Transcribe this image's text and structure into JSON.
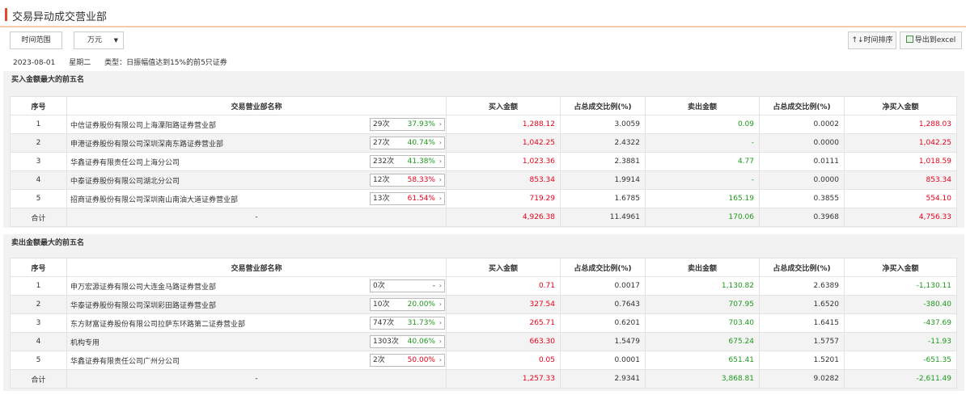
{
  "title": "交易异动成交营业部",
  "toolbar": {
    "range_label": "时间范围",
    "unit_label": "万元",
    "sort_label": "时间排序",
    "sort_icon": "↑↓",
    "export_label": "导出到excel"
  },
  "info": {
    "date": "2023-08-01",
    "weekday": "星期二",
    "type": "类型：日振幅值达到15%的前5只证券"
  },
  "headers": [
    "序号",
    "交易营业部名称",
    "买入金额",
    "占总成交比例(%)",
    "卖出金额",
    "占总成交比例(%)",
    "净买入金额"
  ],
  "buy_section": {
    "title": "买入金额最大的前五名",
    "rows": [
      {
        "idx": "1",
        "name": "中信证券股份有限公司上海溧阳路证券营业部",
        "count": "29次",
        "pct": "37.93%",
        "buy": "1,288.12",
        "buy_ratio": "3.0059",
        "sell": "0.09",
        "sell_ratio": "0.0002",
        "net": "1,288.03"
      },
      {
        "idx": "2",
        "name": "申港证券股份有限公司深圳深南东路证券营业部",
        "count": "27次",
        "pct": "40.74%",
        "buy": "1,042.25",
        "buy_ratio": "2.4322",
        "sell": "-",
        "sell_ratio": "0.0000",
        "net": "1,042.25"
      },
      {
        "idx": "3",
        "name": "华鑫证券有限责任公司上海分公司",
        "count": "232次",
        "pct": "41.38%",
        "buy": "1,023.36",
        "buy_ratio": "2.3881",
        "sell": "4.77",
        "sell_ratio": "0.0111",
        "net": "1,018.59"
      },
      {
        "idx": "4",
        "name": "中泰证券股份有限公司湖北分公司",
        "count": "12次",
        "pct": "58.33%",
        "buy": "853.34",
        "buy_ratio": "1.9914",
        "sell": "-",
        "sell_ratio": "0.0000",
        "net": "853.34"
      },
      {
        "idx": "5",
        "name": "招商证券股份有限公司深圳南山南油大道证券营业部",
        "count": "13次",
        "pct": "61.54%",
        "buy": "719.29",
        "buy_ratio": "1.6785",
        "sell": "165.19",
        "sell_ratio": "0.3855",
        "net": "554.10"
      }
    ],
    "total": {
      "label": "合计",
      "name": "-",
      "buy": "4,926.38",
      "buy_ratio": "11.4961",
      "sell": "170.06",
      "sell_ratio": "0.3968",
      "net": "4,756.33"
    }
  },
  "sell_section": {
    "title": "卖出金额最大的前五名",
    "rows": [
      {
        "idx": "1",
        "name": "申万宏源证券有限公司大连金马路证券营业部",
        "count": "0次",
        "pct": "-",
        "buy": "0.71",
        "buy_ratio": "0.0017",
        "sell": "1,130.82",
        "sell_ratio": "2.6389",
        "net": "-1,130.11"
      },
      {
        "idx": "2",
        "name": "华泰证券股份有限公司深圳彩田路证券营业部",
        "count": "10次",
        "pct": "20.00%",
        "buy": "327.54",
        "buy_ratio": "0.7643",
        "sell": "707.95",
        "sell_ratio": "1.6520",
        "net": "-380.40"
      },
      {
        "idx": "3",
        "name": "东方财富证券股份有限公司拉萨东环路第二证券营业部",
        "count": "747次",
        "pct": "31.73%",
        "buy": "265.71",
        "buy_ratio": "0.6201",
        "sell": "703.40",
        "sell_ratio": "1.6415",
        "net": "-437.69"
      },
      {
        "idx": "4",
        "name": "机构专用",
        "count": "1303次",
        "pct": "40.06%",
        "buy": "663.30",
        "buy_ratio": "1.5479",
        "sell": "675.24",
        "sell_ratio": "1.5757",
        "net": "-11.93"
      },
      {
        "idx": "5",
        "name": "华鑫证券有限责任公司广州分公司",
        "count": "2次",
        "pct": "50.00%",
        "buy": "0.05",
        "buy_ratio": "0.0001",
        "sell": "651.41",
        "sell_ratio": "1.5201",
        "net": "-651.35"
      }
    ],
    "total": {
      "label": "合计",
      "name": "-",
      "buy": "1,257.33",
      "buy_ratio": "2.9341",
      "sell": "3,868.81",
      "sell_ratio": "9.0282",
      "net": "-2,611.49"
    }
  },
  "colors": {
    "up": "#e8001a",
    "down": "#1b9a1b",
    "accent": "#e34b2c"
  }
}
